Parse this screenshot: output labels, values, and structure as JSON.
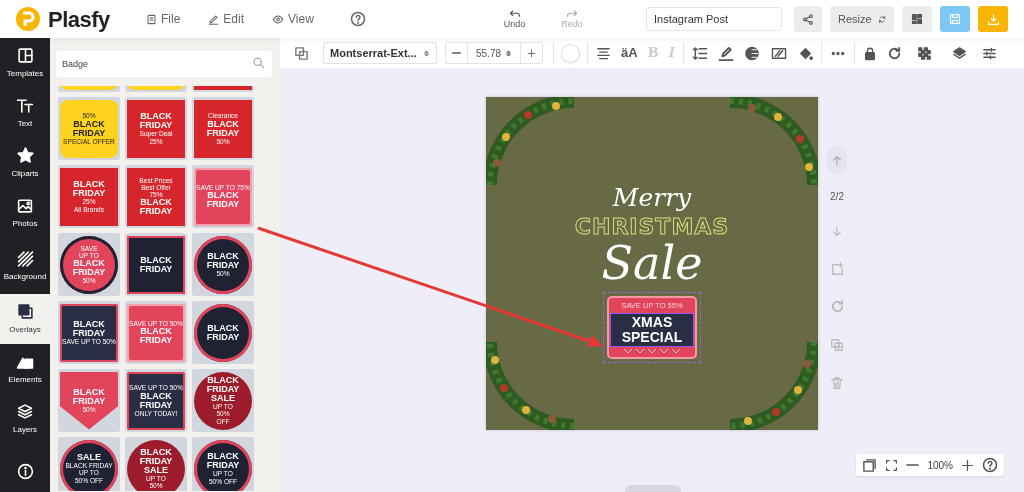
{
  "app": {
    "name": "Plasfy"
  },
  "menu": [
    {
      "kind": "file",
      "label": "File"
    },
    {
      "kind": "edit",
      "label": "Edit"
    },
    {
      "kind": "view",
      "label": "View"
    }
  ],
  "history": [
    {
      "kind": "undo",
      "label": "Undo",
      "disabled": false
    },
    {
      "kind": "redo",
      "label": "Redo",
      "disabled": true
    }
  ],
  "document": {
    "title": "Instagram Post"
  },
  "actions": [
    {
      "kind": "share"
    },
    {
      "kind": "resize",
      "label": "Resize"
    },
    {
      "kind": "layout"
    },
    {
      "kind": "save"
    },
    {
      "kind": "download"
    }
  ],
  "sidebar": [
    {
      "kind": "templates",
      "label": "Templates",
      "selected": false
    },
    {
      "kind": "text",
      "label": "Text",
      "selected": false
    },
    {
      "kind": "cliparts",
      "label": "Cliparts",
      "selected": false
    },
    {
      "kind": "photos",
      "label": "Photos",
      "selected": false
    },
    {
      "kind": "background",
      "label": "Background",
      "selected": false
    },
    {
      "kind": "overlays",
      "label": "Overlays",
      "selected": true
    },
    {
      "kind": "elements",
      "label": "Elements",
      "selected": false
    },
    {
      "kind": "layers",
      "label": "Layers",
      "selected": false
    }
  ],
  "search": {
    "value": "Badge"
  },
  "tiles": [
    {
      "kind": "yellow"
    },
    {
      "kind": "yellow"
    },
    {
      "kind": "red"
    },
    {
      "kind": "yellow",
      "above": [
        "50%"
      ],
      "headline": [
        "BLACK",
        "FRIDAY"
      ],
      "below": [
        "SPECIAL OFFER"
      ]
    },
    {
      "kind": "red",
      "headline": [
        "BLACK",
        "FRIDAY"
      ],
      "below": [
        "Super Deal",
        "25%"
      ]
    },
    {
      "kind": "red",
      "above": [
        "Clearance"
      ],
      "headline": [
        "BLACK",
        "FRIDAY"
      ],
      "below": [
        "50%"
      ]
    },
    {
      "kind": "red",
      "headline": [
        "BLACK",
        "FRIDAY"
      ],
      "below": [
        "25%",
        "All Brands"
      ]
    },
    {
      "kind": "red",
      "above": [
        "Best Prices",
        "Best Offer",
        "75%"
      ],
      "headline": [
        "BLACK",
        "FRIDAY"
      ]
    },
    {
      "kind": "frame",
      "above": [
        "SAVE UP TO 75%"
      ],
      "headline": [
        "BLACK",
        "FRIDAY"
      ]
    },
    {
      "kind": "round",
      "above": [
        "SAVE",
        "UP TO"
      ],
      "headline": [
        "BLACK",
        "FRIDAY"
      ],
      "below": [
        "50%"
      ]
    },
    {
      "kind": "diamond",
      "headline": [
        "BLACK",
        "FRIDAY"
      ]
    },
    {
      "kind": "pin",
      "headline": [
        "BLACK",
        "FRIDAY"
      ],
      "below": [
        "50%"
      ]
    },
    {
      "kind": "navy",
      "headline": [
        "BLACK",
        "FRIDAY"
      ],
      "below": [
        "SAVE UP TO 50%"
      ]
    },
    {
      "kind": "frame",
      "above": [
        "SAVE UP TO 50%"
      ],
      "headline": [
        "BLACK",
        "FRIDAY"
      ]
    },
    {
      "kind": "pin",
      "headline": [
        "BLACK",
        "FRIDAY"
      ]
    },
    {
      "kind": "triangle",
      "headline": [
        "BLACK",
        "FRIDAY"
      ],
      "below": [
        "50%"
      ]
    },
    {
      "kind": "navy",
      "above": [
        "SAVE UP TO 50%"
      ],
      "headline": [
        "BLACK",
        "FRIDAY"
      ],
      "below": [
        "ONLY TODAY!"
      ]
    },
    {
      "kind": "seal",
      "headline": [
        "BLACK",
        "FRIDAY",
        "SALE"
      ],
      "below": [
        "UP TO",
        "50%",
        "OFF"
      ]
    },
    {
      "kind": "pin",
      "headline": [
        "SALE"
      ],
      "below": [
        "BLACK FRIDAY",
        "UP TO",
        "50% OFF"
      ]
    },
    {
      "kind": "seal",
      "headline": [
        "BLACK",
        "FRIDAY",
        "SALE"
      ],
      "below": [
        "UP TO",
        "50%"
      ]
    },
    {
      "kind": "pin",
      "headline": [
        "BLACK",
        "FRIDAY"
      ],
      "below": [
        "UP TO",
        "50% OFF"
      ]
    }
  ],
  "toolbar": {
    "font": "Montserrat-Ext...",
    "size": "55.78",
    "tools": [
      {
        "kind": "color"
      },
      {
        "kind": "align"
      },
      {
        "kind": "case",
        "label": "äA"
      },
      {
        "kind": "bold",
        "label": "B",
        "disabled": true
      },
      {
        "kind": "italic",
        "label": "I",
        "disabled": true
      },
      {
        "kind": "spacing"
      },
      {
        "kind": "pen"
      },
      {
        "kind": "effect"
      },
      {
        "kind": "shadow"
      },
      {
        "kind": "fill"
      },
      {
        "kind": "more"
      },
      {
        "kind": "lock"
      },
      {
        "kind": "rotate"
      },
      {
        "kind": "transparency"
      },
      {
        "kind": "layers"
      },
      {
        "kind": "adjust"
      }
    ]
  },
  "canvas": {
    "greeting": "Merry",
    "headline": "CHRISTMAS",
    "tagline": "Sale",
    "badge": {
      "top": "SAVE UP TO 55%",
      "lines": [
        "XMAS",
        "SPECIAL"
      ],
      "selected": true
    }
  },
  "pages": {
    "counter": "2/2"
  },
  "zoom": {
    "value": "100%"
  }
}
